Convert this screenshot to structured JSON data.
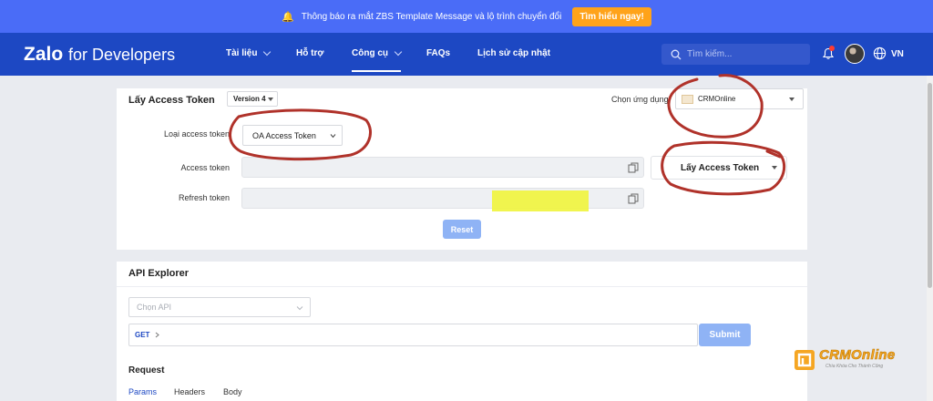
{
  "announcement": {
    "text": "Thông báo ra mắt ZBS Template Message và lộ trình chuyển đổi",
    "cta": "Tìm hiểu ngay!"
  },
  "navbar": {
    "logo_brand": "Zalo",
    "logo_suffix": "for Developers",
    "items": [
      {
        "label": "Tài liệu",
        "has_dropdown": true
      },
      {
        "label": "Hỗ trợ",
        "has_dropdown": false
      },
      {
        "label": "Công cụ",
        "has_dropdown": true,
        "active": true
      },
      {
        "label": "FAQs",
        "has_dropdown": false
      },
      {
        "label": "Lịch sử cập nhật",
        "has_dropdown": false
      }
    ],
    "search_placeholder": "Tìm kiếm...",
    "language": "VN"
  },
  "token_panel": {
    "title": "Lấy Access Token",
    "version": "Version 4",
    "app_label": "Chọn ứng dụng",
    "app_selected": "CRMOnline",
    "token_type_label": "Loại access token",
    "token_type_value": "OA Access Token",
    "access_token_label": "Access token",
    "refresh_token_label": "Refresh token",
    "get_token_button": "Lấy Access Token",
    "reset_button": "Reset"
  },
  "api_explorer": {
    "title": "API Explorer",
    "api_placeholder": "Chọn API",
    "method": "GET",
    "submit_button": "Submit",
    "request_title": "Request",
    "tabs": [
      "Params",
      "Headers",
      "Body"
    ]
  },
  "watermark": {
    "brand": "CRMOnline",
    "tagline": "Chìa Khóa Cho Thành Công"
  },
  "colors": {
    "announce_bg": "#4a6cf7",
    "navbar_bg": "#1d48c3",
    "cta": "#ffa31a",
    "button_disabled": "#8fb3f5",
    "annotation_red": "#b0322a",
    "highlight_yellow": "#f0f43c"
  }
}
